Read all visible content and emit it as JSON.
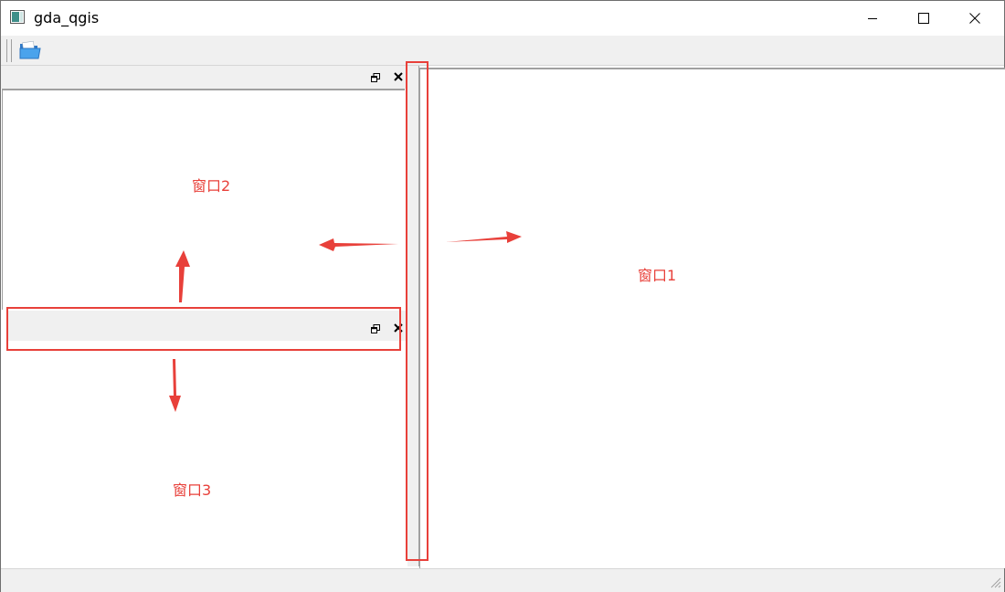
{
  "window": {
    "title": "gda_qgis",
    "app_icon": "window-app-icon",
    "controls": {
      "minimize": "minimize-icon",
      "maximize": "maximize-icon",
      "close": "close-icon"
    }
  },
  "toolbar": {
    "items": [
      {
        "name": "open-folder-button",
        "icon": "folder-open-icon"
      }
    ]
  },
  "docks": {
    "dock2": {
      "label": "窗口2",
      "float_icon": "float-icon",
      "close_icon": "close-icon"
    },
    "dock3": {
      "label": "窗口3",
      "float_icon": "float-icon",
      "close_icon": "close-icon"
    }
  },
  "main": {
    "label": "窗口1"
  },
  "annotations": {
    "color": "#e8403a",
    "arrow_icon": "arrow-icon"
  },
  "colors": {
    "panel_bg": "#f0f0f0",
    "annotation_red": "#e8403a"
  }
}
